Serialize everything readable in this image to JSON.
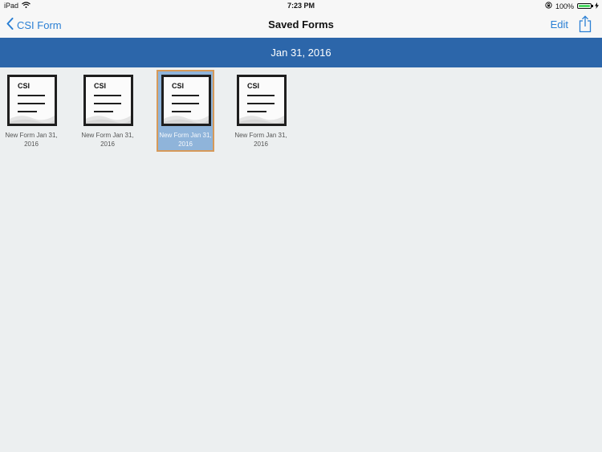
{
  "status_bar": {
    "device": "iPad",
    "time": "7:23 PM",
    "battery": "100%"
  },
  "nav": {
    "back_label": "CSI Form",
    "title": "Saved Forms",
    "edit_label": "Edit"
  },
  "section": {
    "date": "Jan 31, 2016"
  },
  "forms": [
    {
      "name": "New Form Jan 31, 2016",
      "icon_text": "CSI",
      "selected": false
    },
    {
      "name": "New Form Jan 31, 2016",
      "icon_text": "CSI",
      "selected": false
    },
    {
      "name": "New Form Jan 31, 2016",
      "icon_text": "CSI",
      "selected": true
    },
    {
      "name": "New Form Jan 31, 2016",
      "icon_text": "CSI",
      "selected": false
    }
  ],
  "colors": {
    "accent": "#2a7fd4",
    "header_bg": "#2c66aa",
    "selected_bg": "#8fb4da",
    "selected_border": "#d69a5a",
    "battery": "#4cd964"
  }
}
